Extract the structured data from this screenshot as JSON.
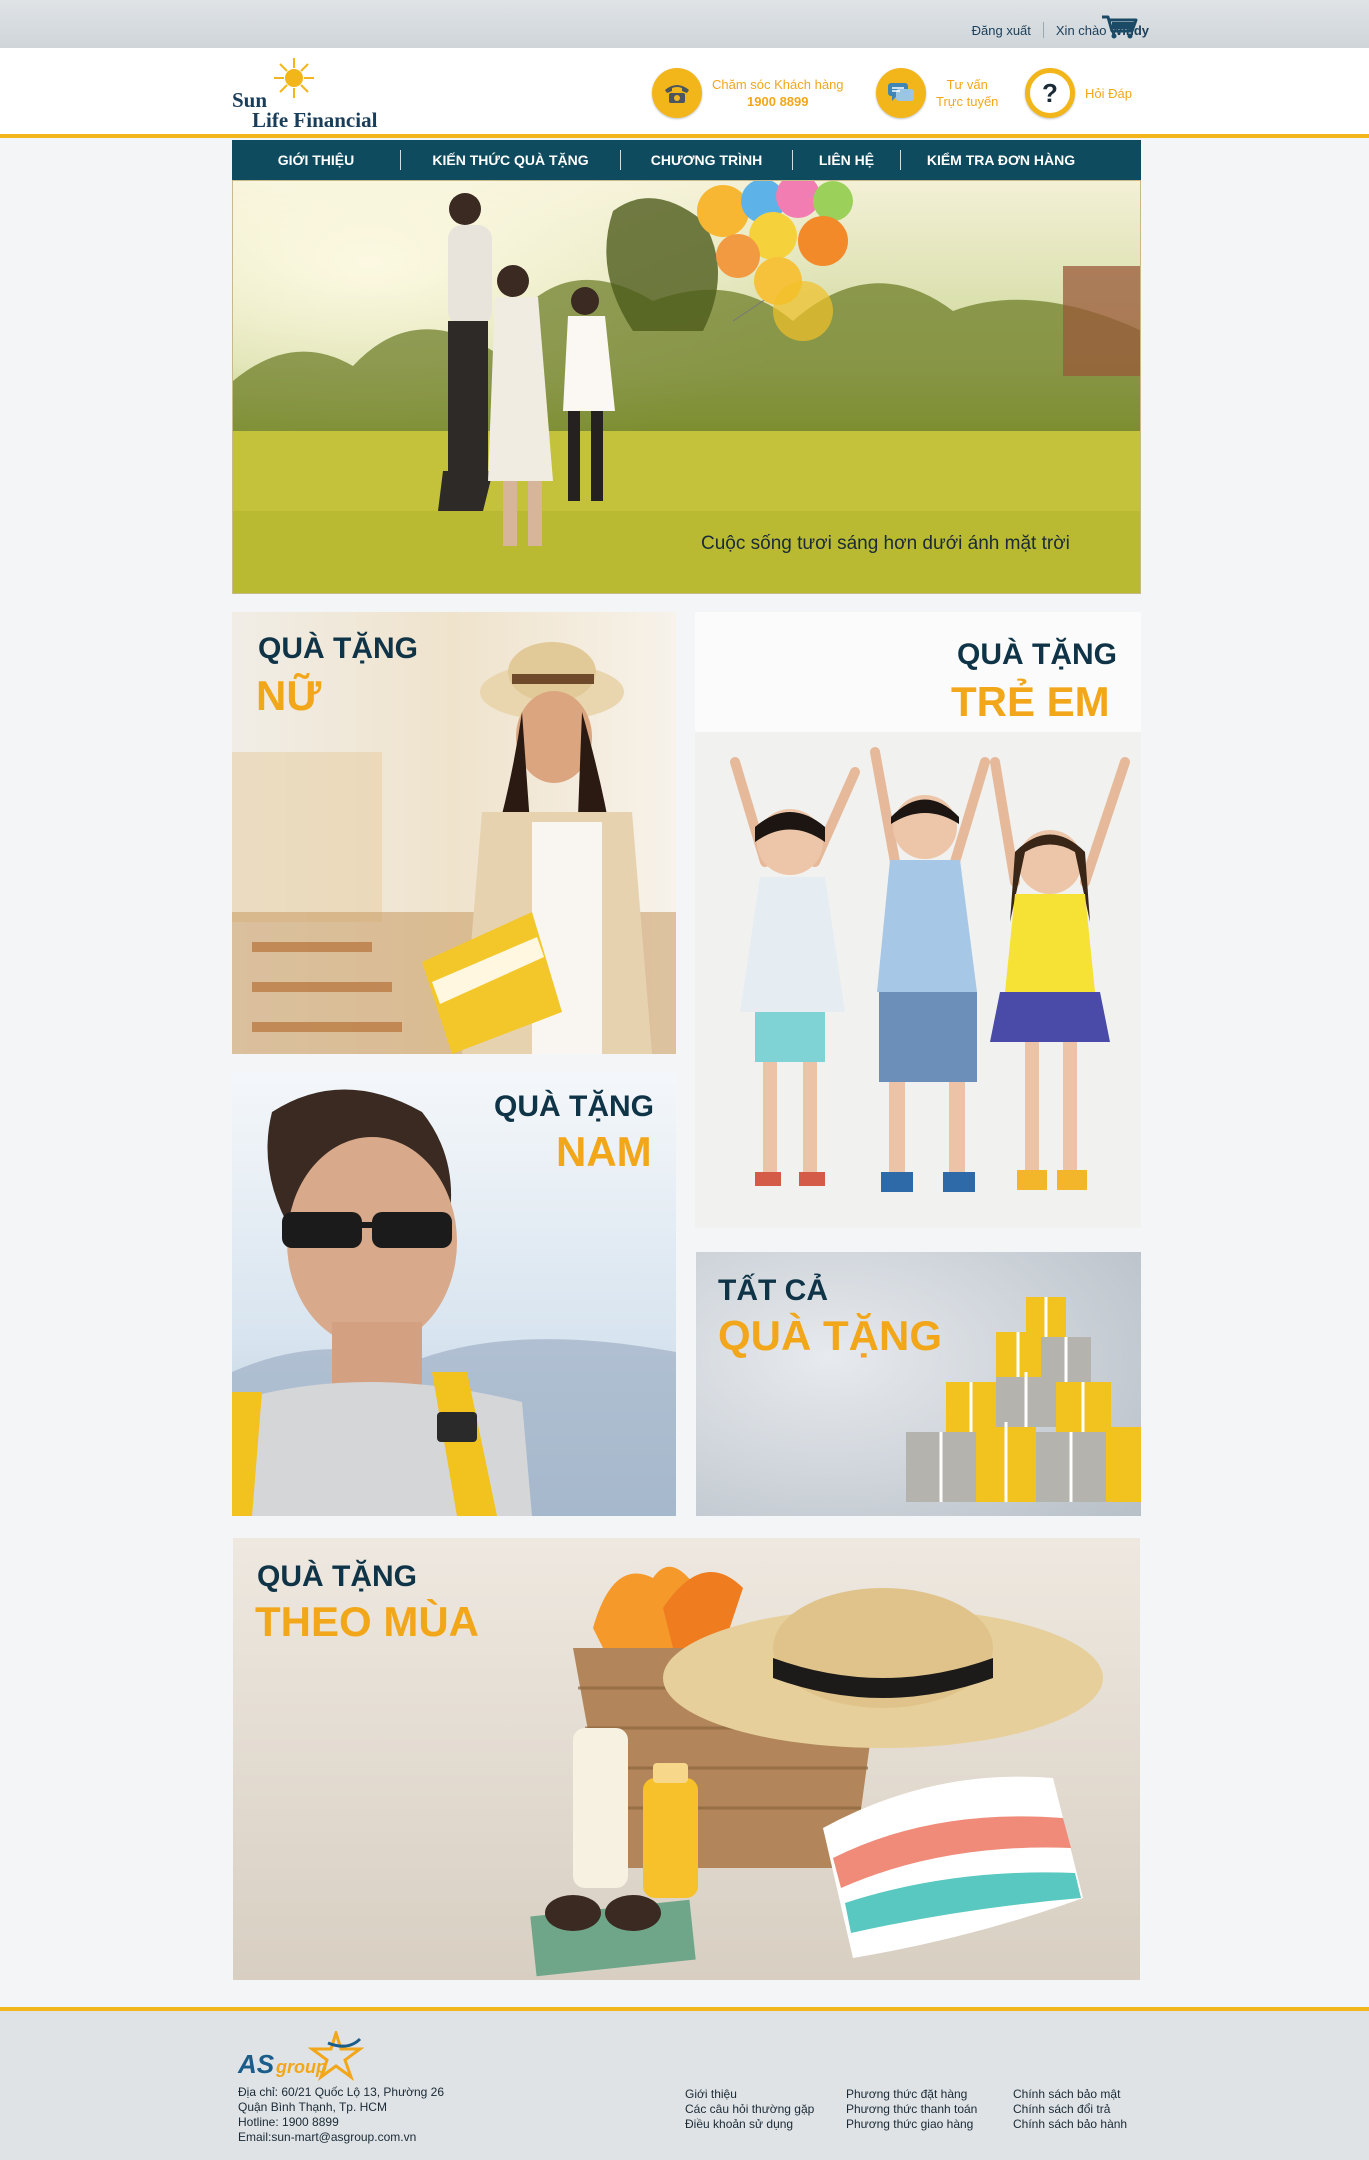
{
  "topbar": {
    "logout": "Đăng xuất",
    "greeting": "Xin chào",
    "username": "Windy"
  },
  "header": {
    "brand_line1": "Sun",
    "brand_line2": "Life Financial",
    "care_label": "Chăm sóc Khách hàng",
    "care_phone": "1900 8899",
    "consult_line1": "Tư vấn",
    "consult_line2": "Trực tuyến",
    "faq_label": "Hỏi Đáp"
  },
  "nav": {
    "items": [
      "GIỚI THIỆU",
      "KIẾN THỨC QUÀ TẶNG",
      "CHƯƠNG TRÌNH",
      "LIÊN HỆ",
      "KIỂM TRA ĐƠN HÀNG"
    ]
  },
  "hero": {
    "caption": "Cuộc sống tươi sáng hơn dưới ánh mặt trời"
  },
  "tiles": {
    "women": {
      "line1": "QUÀ TẶNG",
      "line2": "NỮ"
    },
    "kids": {
      "line1": "QUÀ TẶNG",
      "line2": "TRẺ EM"
    },
    "men": {
      "line1": "QUÀ TẶNG",
      "line2": "NAM"
    },
    "all": {
      "line1": "TẤT CẢ",
      "line2": "QUÀ TẶNG"
    },
    "season": {
      "line1": "QUÀ TẶNG",
      "line2": "THEO MÙA"
    }
  },
  "footer": {
    "logo_as": "AS",
    "logo_group": "group",
    "address": [
      "Địa chỉ: 60/21 Quốc Lộ 13, Phường 26",
      "Quận Bình Thạnh, Tp. HCM",
      "Hotline: 1900 8899",
      "Email:sun-mart@asgroup.com.vn"
    ],
    "col1": [
      "Giới thiệu",
      "Các câu hỏi thường gặp",
      "Điều khoản sử dụng"
    ],
    "col2": [
      "Phương thức đặt hàng",
      "Phương thức thanh toán",
      "Phương thức giao hàng"
    ],
    "col3": [
      "Chính sách bảo mật",
      "Chính sách đổi trả",
      "Chính sách bảo hành"
    ]
  },
  "colors": {
    "accent": "#f2b61a",
    "nav_bg": "#0f4b5e",
    "title_dark": "#103447",
    "title_gold": "#f2a71a"
  }
}
